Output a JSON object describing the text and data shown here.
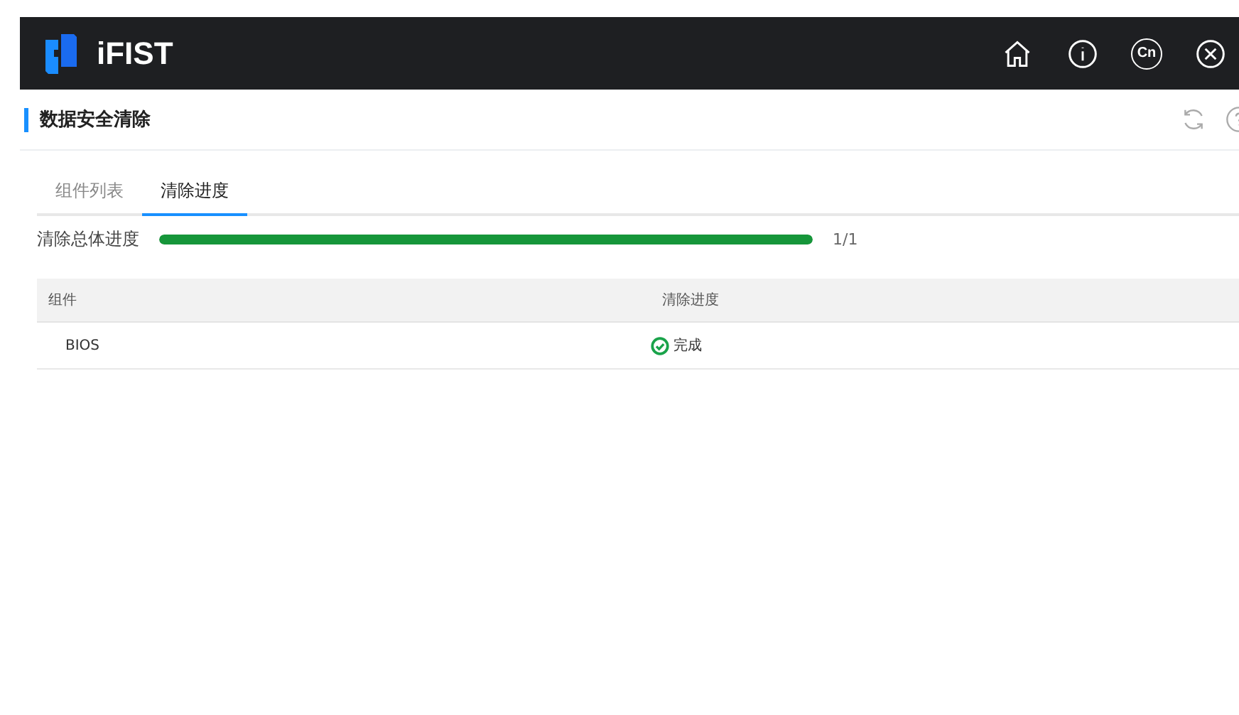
{
  "header": {
    "title": "iFIST",
    "language": "Cn"
  },
  "page": {
    "title": "数据安全清除"
  },
  "tabs": [
    {
      "label": "组件列表",
      "selected": false
    },
    {
      "label": "清除进度",
      "selected": true
    }
  ],
  "overall": {
    "label": "清除总体进度",
    "level": 1,
    "reading": "1/1"
  },
  "table": {
    "columns": [
      "组件",
      "清除进度"
    ],
    "rows": [
      {
        "component": "BIOS",
        "status": "完成",
        "kind": "done"
      }
    ]
  }
}
